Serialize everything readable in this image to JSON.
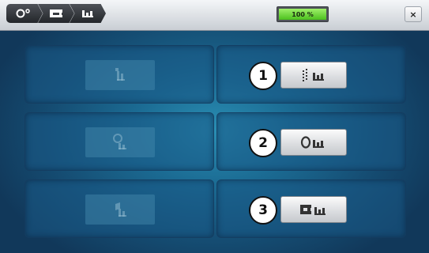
{
  "header": {
    "crumbs": [
      {
        "icon": "thread-tension-icon"
      },
      {
        "icon": "sewing-machine-icon"
      },
      {
        "icon": "presser-foot-icon"
      }
    ],
    "progress_text": "100 %",
    "progress_fraction": 1.0,
    "close_label": "×"
  },
  "panels": {
    "left": [
      {
        "icon": "disabled-option-1-icon",
        "state": "disabled"
      },
      {
        "icon": "disabled-option-2-icon",
        "state": "disabled"
      },
      {
        "icon": "disabled-option-3-icon",
        "state": "disabled"
      }
    ],
    "right": [
      {
        "number": "1",
        "icon": "dotted-line-foot-icon"
      },
      {
        "number": "2",
        "icon": "ring-foot-icon"
      },
      {
        "number": "3",
        "icon": "machine-foot-icon"
      }
    ]
  },
  "colors": {
    "accent_progress": "#4cc01e",
    "background": "#1b6b93"
  }
}
